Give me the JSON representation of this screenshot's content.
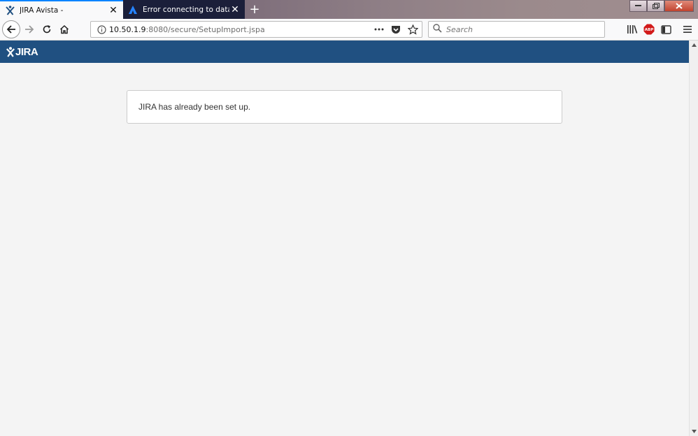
{
  "browser": {
    "tabs": [
      {
        "title": "JIRA Avista -",
        "favicon": "jira-favicon",
        "active": true
      },
      {
        "title": "Error connecting to database",
        "favicon": "atlassian-favicon",
        "active": false
      }
    ],
    "url": {
      "host": "10.50.1.9",
      "rest": ":8080/secure/SetupImport.jspa"
    },
    "search_placeholder": "Search",
    "new_tab_label": "+",
    "close_label": "✕"
  },
  "header": {
    "logo_text": "JIRA",
    "bg_color": "#205081"
  },
  "main": {
    "message": "JIRA has already been set up."
  }
}
